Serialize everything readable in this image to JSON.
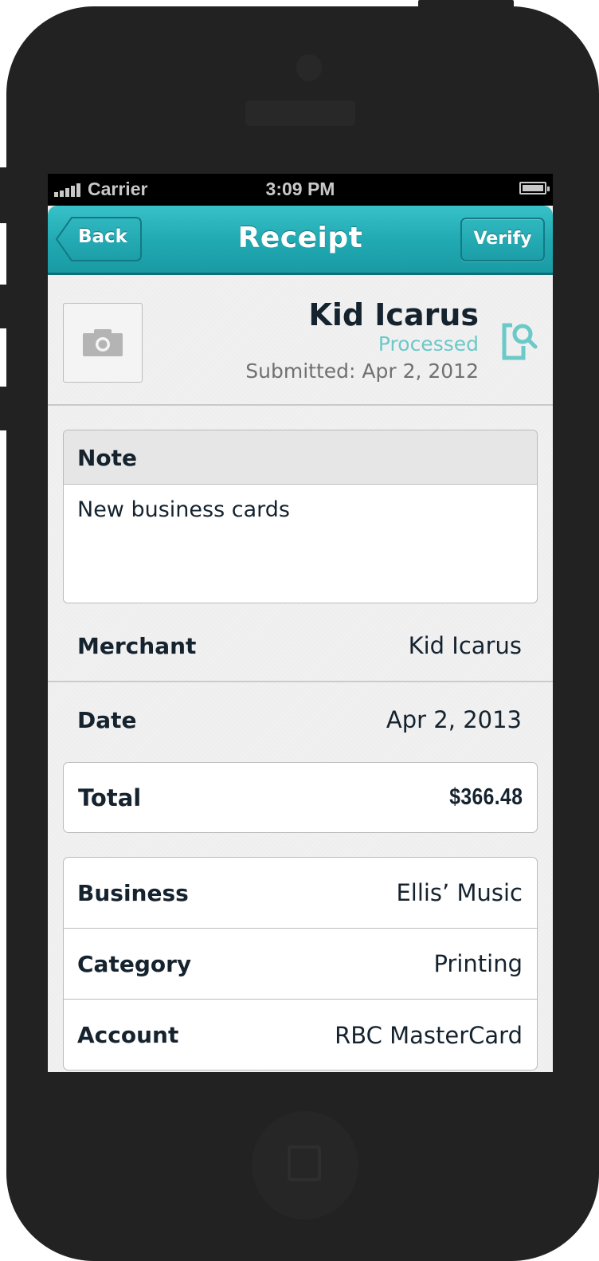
{
  "status_bar": {
    "carrier": "Carrier",
    "time": "3:09 PM",
    "signal_bars": 5,
    "battery_level": 1.0
  },
  "nav": {
    "title": "Receipt",
    "back_label": "Back",
    "verify_label": "Verify"
  },
  "receipt": {
    "merchant_name": "Kid Icarus",
    "status": "Processed",
    "submitted": "Submitted: Apr 2, 2012",
    "photo_icon": "camera-icon",
    "verify_icon": "document-search-icon"
  },
  "note": {
    "label": "Note",
    "text": "New business cards"
  },
  "fields": {
    "merchant": {
      "label": "Merchant",
      "value": "Kid Icarus"
    },
    "date": {
      "label": "Date",
      "value": "Apr 2, 2013"
    },
    "total": {
      "label": "Total",
      "value": "$366.48"
    }
  },
  "details": [
    {
      "label": "Business",
      "value": "Ellis’ Music"
    },
    {
      "label": "Category",
      "value": "Printing"
    },
    {
      "label": "Account",
      "value": "RBC MasterCard"
    }
  ],
  "colors": {
    "accent": "#20a8b1",
    "status_processed": "#6bc9c8",
    "text_dark": "#15232f",
    "device": "#222222"
  }
}
